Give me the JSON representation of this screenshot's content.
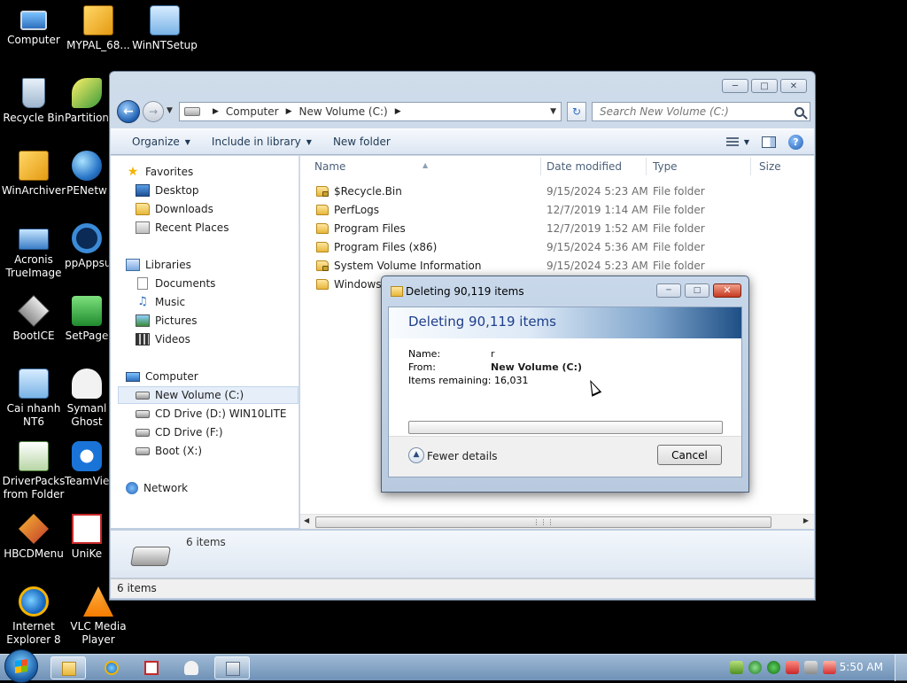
{
  "desktop": {
    "icons": [
      {
        "label": "Computer",
        "icon": "computer-icon"
      },
      {
        "label": "MYPAL_68...",
        "icon": "archive-box-icon"
      },
      {
        "label": "WinNTSetup",
        "icon": "setup-icon"
      },
      {
        "label": "Recycle Bin",
        "icon": "recycle-bin-icon"
      },
      {
        "label": "Partition",
        "icon": "partition-wizard-icon"
      },
      {
        "label": "WinArchiver",
        "icon": "winarchiver-icon"
      },
      {
        "label": "PENetw",
        "icon": "network-globe-icon"
      },
      {
        "label": "Acronis TrueImage",
        "icon": "acronis-icon"
      },
      {
        "label": "ppAppsu",
        "icon": "ppapps-icon"
      },
      {
        "label": "BootICE",
        "icon": "bootice-icon"
      },
      {
        "label": "SetPage",
        "icon": "setpage-icon"
      },
      {
        "label": "Cai nhanh NT6",
        "icon": "installer-icon"
      },
      {
        "label": "Symanl Ghost",
        "icon": "ghost-icon"
      },
      {
        "label": "DriverPacks from Folder",
        "icon": "driverpacks-icon"
      },
      {
        "label": "TeamVie",
        "icon": "teamviewer-icon"
      },
      {
        "label": "HBCDMenu",
        "icon": "tools-icon"
      },
      {
        "label": "UniKe",
        "icon": "unikey-icon"
      },
      {
        "label": "Internet Explorer 8",
        "icon": "internet-explorer-icon"
      },
      {
        "label": "VLC Media Player",
        "icon": "vlc-icon"
      }
    ]
  },
  "explorer": {
    "breadcrumb": [
      "Computer",
      "New Volume (C:)"
    ],
    "search_placeholder": "Search New Volume (C:)",
    "toolbar": {
      "organize": "Organize",
      "include": "Include in library",
      "new_folder": "New folder"
    },
    "nav": {
      "favorites": "Favorites",
      "desktop": "Desktop",
      "downloads": "Downloads",
      "recent": "Recent Places",
      "libraries": "Libraries",
      "documents": "Documents",
      "music": "Music",
      "pictures": "Pictures",
      "videos": "Videos",
      "computer": "Computer",
      "drive_c": "New Volume (C:)",
      "drive_d": "CD Drive (D:) WIN10LITE",
      "drive_f": "CD Drive (F:)",
      "drive_x": "Boot (X:)",
      "network": "Network"
    },
    "columns": {
      "name": "Name",
      "date": "Date modified",
      "type": "Type",
      "size": "Size"
    },
    "files": [
      {
        "name": "$Recycle.Bin",
        "date": "9/15/2024 5:23 AM",
        "type": "File folder",
        "locked": true
      },
      {
        "name": "PerfLogs",
        "date": "12/7/2019 1:14 AM",
        "type": "File folder",
        "locked": false
      },
      {
        "name": "Program Files",
        "date": "12/7/2019 1:52 AM",
        "type": "File folder",
        "locked": false
      },
      {
        "name": "Program Files (x86)",
        "date": "9/15/2024 5:36 AM",
        "type": "File folder",
        "locked": false
      },
      {
        "name": "System Volume Information",
        "date": "9/15/2024 5:23 AM",
        "type": "File folder",
        "locked": true
      },
      {
        "name": "Windows",
        "date": "",
        "type": "",
        "locked": false
      }
    ],
    "details_count": "6 items",
    "status_count": "6 items"
  },
  "dialog": {
    "title": "Deleting 90,119 items",
    "heading": "Deleting 90,119 items",
    "name_label": "Name:",
    "name_value": "r",
    "from_label": "From:",
    "from_value": "New Volume (C:)",
    "remaining_label": "Items remaining:",
    "remaining_value": "16,031",
    "progress_fraction": 0.0,
    "fewer_details": "Fewer details",
    "cancel": "Cancel"
  },
  "taskbar": {
    "clock": "5:50 AM"
  }
}
